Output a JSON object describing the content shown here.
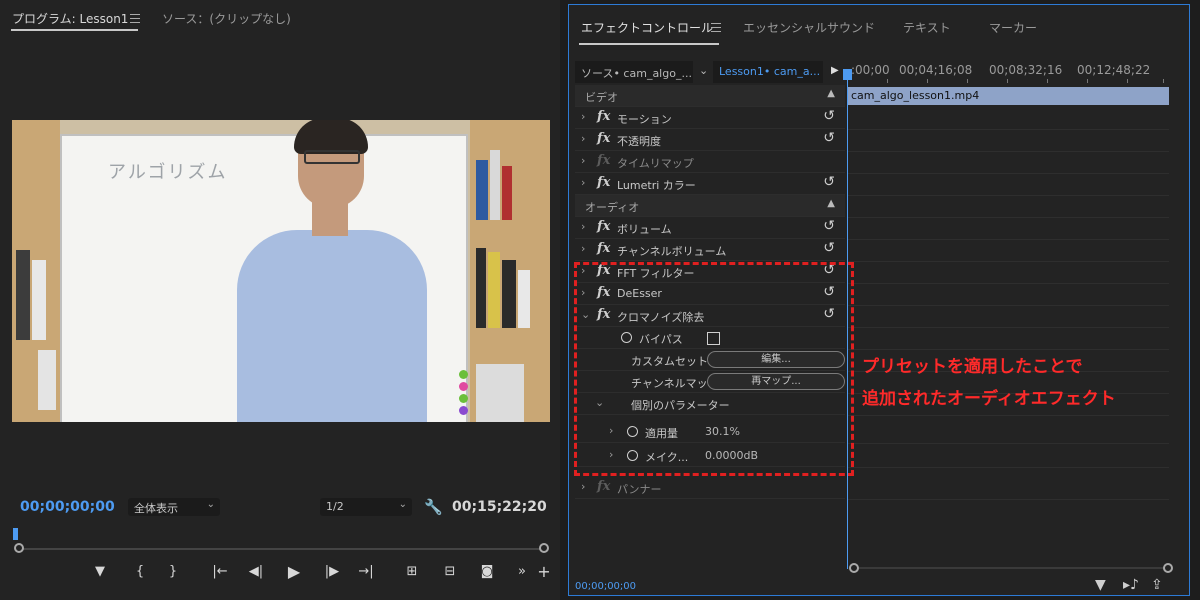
{
  "program": {
    "tab_label": "プログラム: Lesson1",
    "source_tab_label": "ソース：(クリップなし)",
    "board_text": "アルゴリズム",
    "timecode_current": "00;00;00;00",
    "zoom_select": "全体表示",
    "resolution_select": "1/2",
    "timecode_duration": "00;15;22;20",
    "controls": [
      "marker-icon",
      "mark-in-icon",
      "mark-out-icon",
      "go-to-in-icon",
      "step-back-icon",
      "play-icon",
      "step-forward-icon",
      "go-to-out-icon",
      "insert-icon",
      "overwrite-icon",
      "camera-icon",
      "more-icon",
      "plus-icon"
    ]
  },
  "effects": {
    "tabs": [
      "エフェクトコントロール",
      "エッセンシャルサウンド",
      "テキスト",
      "マーカー"
    ],
    "source_label": "ソース• cam_algo_...",
    "sequence_label": "Lesson1• cam_a...",
    "video_section": "ビデオ",
    "video_effects": [
      {
        "label": "モーション"
      },
      {
        "label": "不透明度"
      },
      {
        "label": "タイムリマップ"
      },
      {
        "label": "Lumetri カラー"
      }
    ],
    "audio_section": "オーディオ",
    "audio_effects": [
      {
        "label": "ボリューム"
      },
      {
        "label": "チャンネルボリューム"
      },
      {
        "label": "FFT フィルター"
      },
      {
        "label": "DeEsser"
      },
      {
        "label": "クロマノイズ除去"
      }
    ],
    "bypass_label": "バイパス",
    "custom_setup_label": "カスタムセット",
    "edit_button": "編集...",
    "channel_map_label": "チャンネルマッ",
    "remap_button": "再マップ...",
    "individual_params_label": "個別のパラメーター",
    "amount_label": "適用量",
    "amount_value": "30.1%",
    "makeup_label": "メイク...",
    "makeup_value": "0.0000dB",
    "panner_label": "パンナー",
    "footer_timecode": "00;00;00;00",
    "ruler_labels": [
      ":00;00",
      "00;04;16;08",
      "00;08;32;16",
      "00;12;48;22"
    ],
    "clip_name": "cam_algo_lesson1.mp4"
  },
  "annotation": {
    "line1": "プリセットを適用したことで",
    "line2": "追加されたオーディオエフェクト"
  },
  "colors": {
    "accent_blue": "#4d9bf2",
    "annotation_red": "#ff2a2a",
    "clip_blue": "#8ea3c8"
  }
}
